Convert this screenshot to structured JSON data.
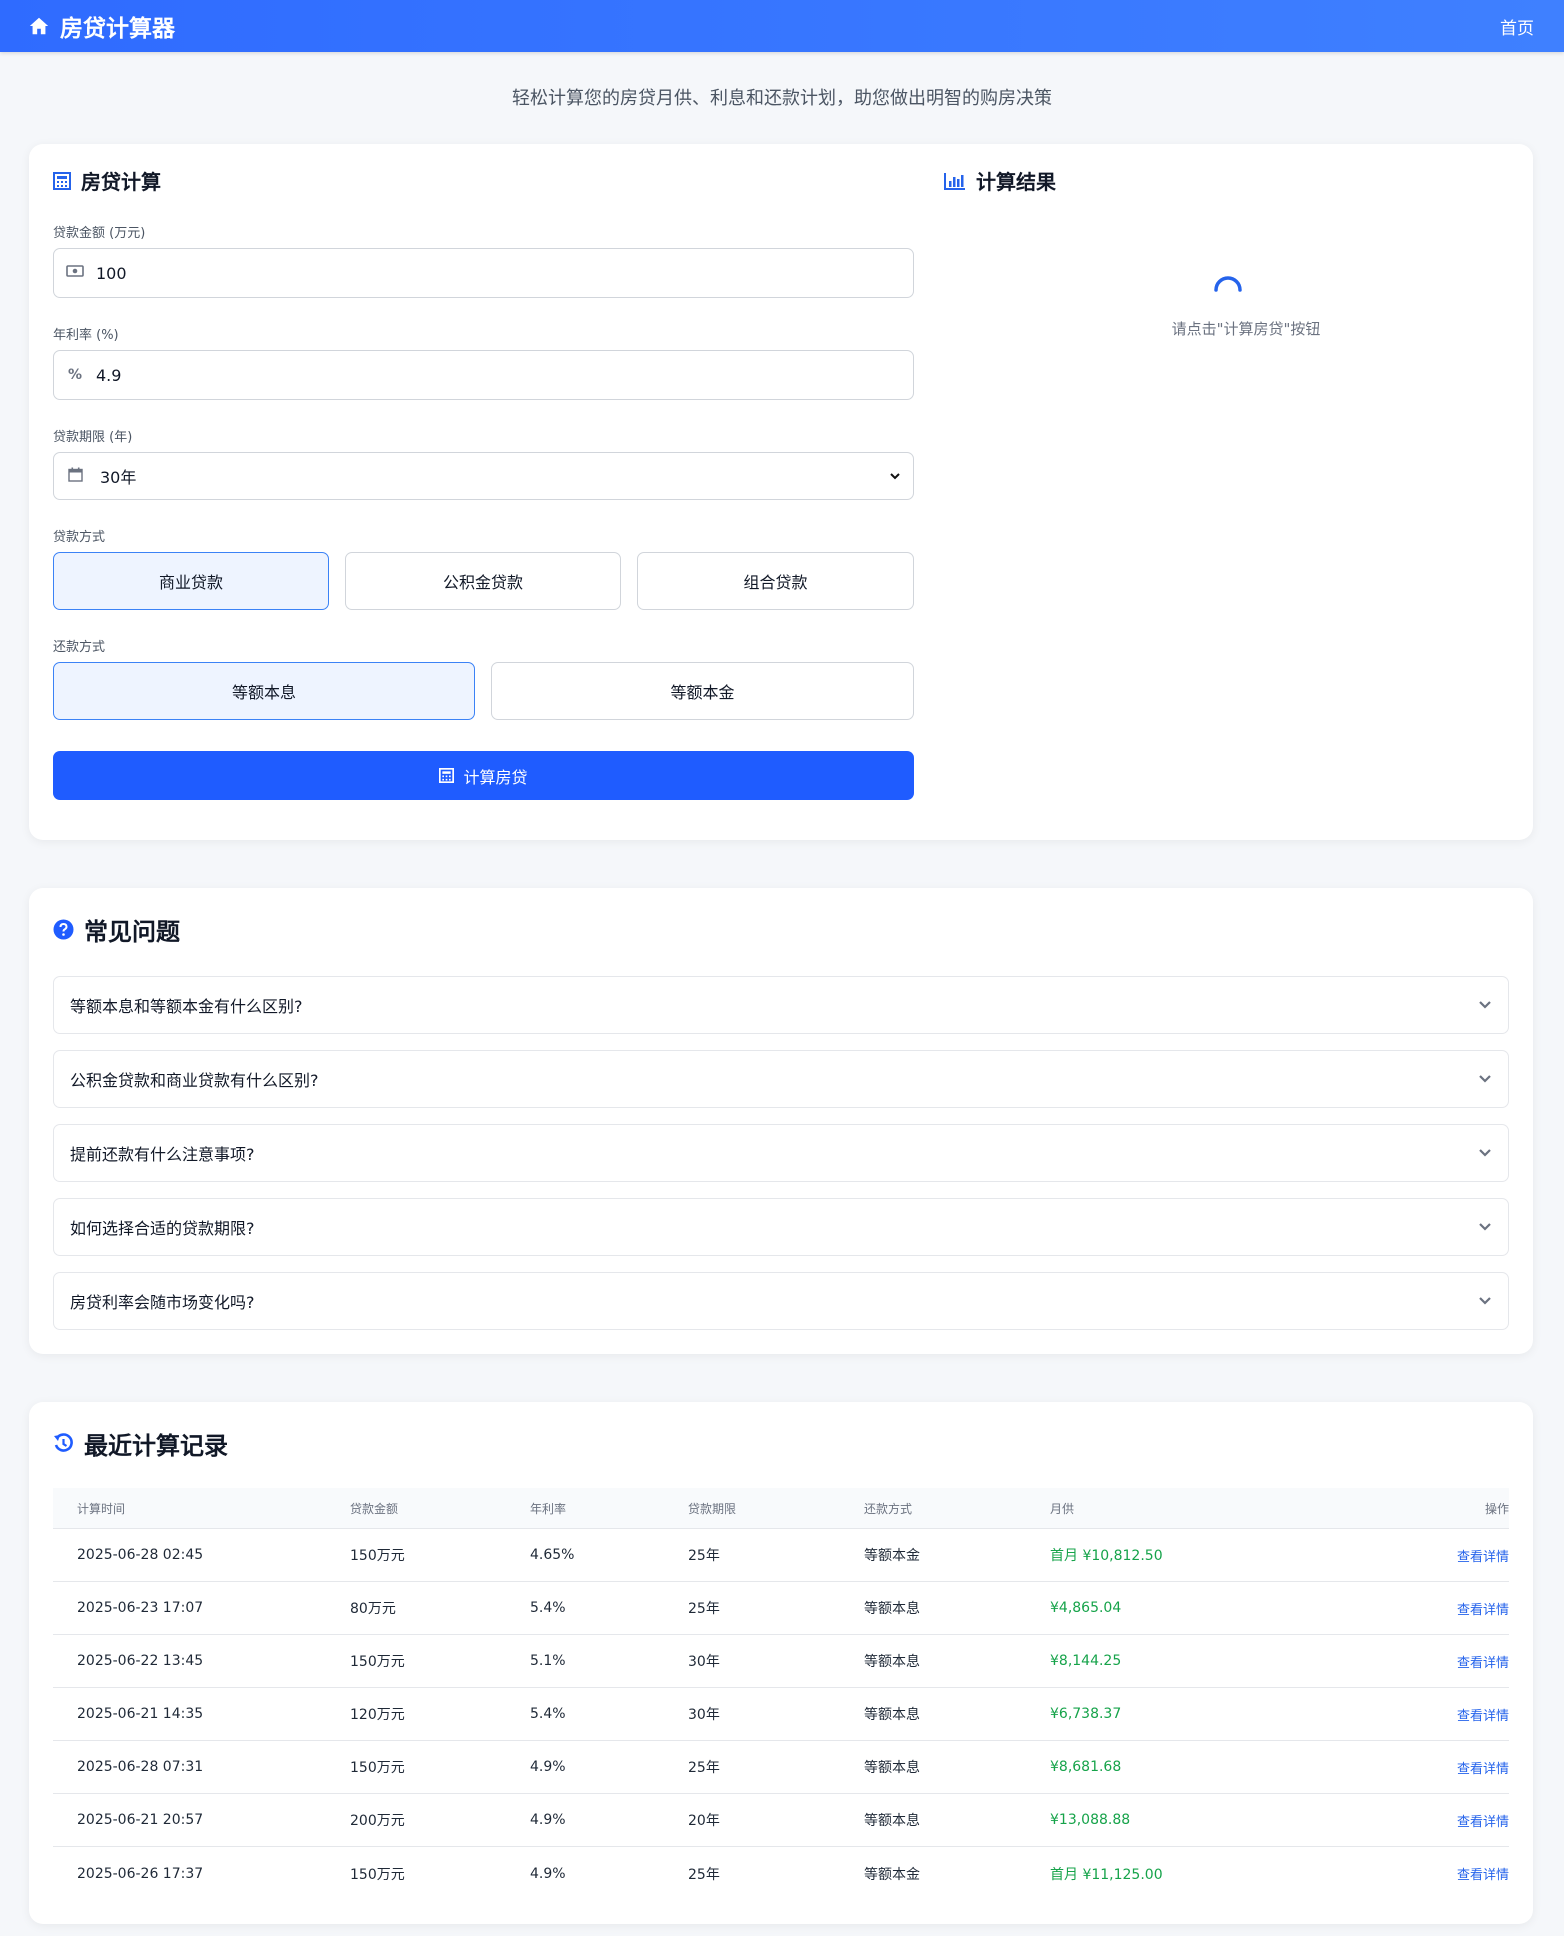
{
  "nav": {
    "brand": "房贷计算器",
    "home": "首页"
  },
  "hero": {
    "subtitle": "轻松计算您的房贷月供、利息和还款计划，助您做出明智的购房决策"
  },
  "calculator": {
    "title": "房贷计算",
    "amount_label": "贷款金额 (万元)",
    "amount_value": "100",
    "rate_label": "年利率 (%)",
    "rate_value": "4.9",
    "term_label": "贷款期限 (年)",
    "term_selected": "30年",
    "loan_type_label": "贷款方式",
    "loan_types": [
      "商业贷款",
      "公积金贷款",
      "组合贷款"
    ],
    "loan_type_selected": "商业贷款",
    "repay_label": "还款方式",
    "repay_types": [
      "等额本息",
      "等额本金"
    ],
    "repay_selected": "等额本息",
    "calc_button": "计算房贷"
  },
  "result": {
    "title": "计算结果",
    "hint": "请点击\"计算房贷\"按钮"
  },
  "faq": {
    "title": "常见问题",
    "items": [
      "等额本息和等额本金有什么区别?",
      "公积金贷款和商业贷款有什么区别?",
      "提前还款有什么注意事项?",
      "如何选择合适的贷款期限?",
      "房贷利率会随市场变化吗?"
    ]
  },
  "history": {
    "title": "最近计算记录",
    "columns": [
      "计算时间",
      "贷款金额",
      "年利率",
      "贷款期限",
      "还款方式",
      "月供",
      "操作"
    ],
    "rows": [
      {
        "time": "2025-06-28 02:45",
        "amount": "150万元",
        "rate": "4.65%",
        "term": "25年",
        "method": "等额本金",
        "monthly": "首月 ¥10,812.50",
        "action": "查看详情"
      },
      {
        "time": "2025-06-23 17:07",
        "amount": "80万元",
        "rate": "5.4%",
        "term": "25年",
        "method": "等额本息",
        "monthly": "¥4,865.04",
        "action": "查看详情"
      },
      {
        "time": "2025-06-22 13:45",
        "amount": "150万元",
        "rate": "5.1%",
        "term": "30年",
        "method": "等额本息",
        "monthly": "¥8,144.25",
        "action": "查看详情"
      },
      {
        "time": "2025-06-21 14:35",
        "amount": "120万元",
        "rate": "5.4%",
        "term": "30年",
        "method": "等额本息",
        "monthly": "¥6,738.37",
        "action": "查看详情"
      },
      {
        "time": "2025-06-28 07:31",
        "amount": "150万元",
        "rate": "4.9%",
        "term": "25年",
        "method": "等额本息",
        "monthly": "¥8,681.68",
        "action": "查看详情"
      },
      {
        "time": "2025-06-21 20:57",
        "amount": "200万元",
        "rate": "4.9%",
        "term": "20年",
        "method": "等额本息",
        "monthly": "¥13,088.88",
        "action": "查看详情"
      },
      {
        "time": "2025-06-26 17:37",
        "amount": "150万元",
        "rate": "4.9%",
        "term": "25年",
        "method": "等额本金",
        "monthly": "首月 ¥11,125.00",
        "action": "查看详情"
      }
    ]
  },
  "colors": {
    "primary": "#1f5cff",
    "nav": "#2f6bff",
    "accent_green": "#16a34a",
    "link": "#2563eb",
    "active_bg": "#eef4ff"
  }
}
